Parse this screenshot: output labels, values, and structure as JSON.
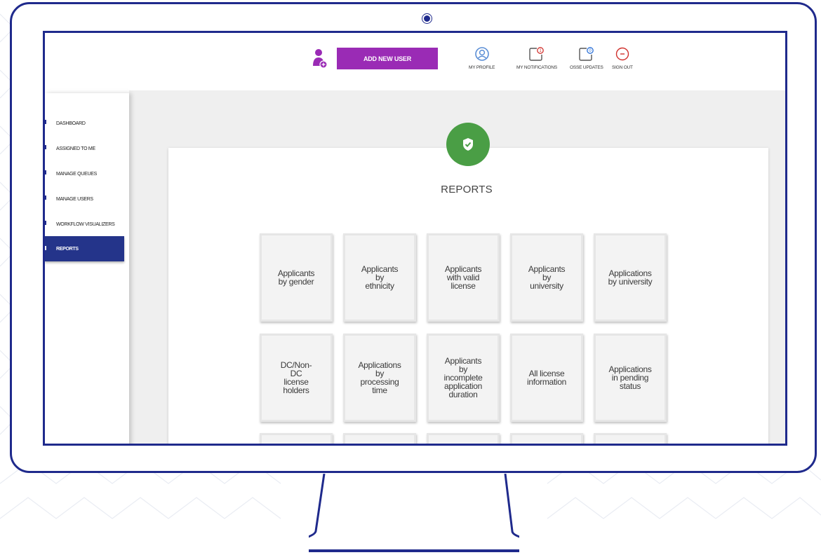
{
  "topbar": {
    "add_user_label": "ADD NEW USER",
    "nav": [
      {
        "label": "MY PROFILE",
        "icon": "profile-icon"
      },
      {
        "label": "MY NOTIFICATIONS",
        "icon": "notification-icon",
        "count": "1"
      },
      {
        "label": "OSSE UPDATES",
        "icon": "updates-icon",
        "count": "0"
      },
      {
        "label": "SIGN OUT",
        "icon": "sign-out-icon"
      }
    ]
  },
  "sidebar": {
    "items": [
      {
        "label": "DASHBOARD"
      },
      {
        "label": "ASSIGNED TO ME"
      },
      {
        "label": "MANAGE QUEUES"
      },
      {
        "label": "MANAGE USERS"
      },
      {
        "label": "WORKFLOW VISUALIZERS"
      },
      {
        "label": "REPORTS",
        "active": true
      }
    ]
  },
  "main": {
    "title": "REPORTS",
    "tiles": [
      "Applicants\nby gender",
      "Applicants\nby\nethnicity",
      "Applicants\nwith valid\nlicense",
      "Applicants\nby\nuniversity",
      "Applications\nby university",
      "DC/Non-\nDC\nlicense\nholders",
      "Applications\nby\nprocessing\ntime",
      "Applicants\nby\nincomplete\napplication\nduration",
      "All license\ninformation",
      "Applications\nin pending\nstatus"
    ]
  },
  "colors": {
    "frame": "#1f2a8c",
    "add_user_button": "#9a2bb5",
    "sidebar_active": "#24348a",
    "badge": "#4a9e45",
    "notification_accent": "#d0312d",
    "updates_accent": "#2a6fd6"
  }
}
